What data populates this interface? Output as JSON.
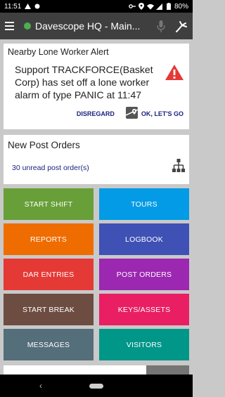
{
  "status_bar": {
    "time": "11:51",
    "battery": "80%",
    "icons": [
      "warning-icon",
      "circle-icon",
      "key-icon",
      "location-icon",
      "wifi-icon",
      "signal-icon",
      "battery-icon"
    ]
  },
  "app_bar": {
    "title": "Davescope HQ - Main...",
    "status_color": "#4caf50",
    "icons": [
      "menu-icon",
      "microphone-icon",
      "hand-icon"
    ]
  },
  "alert": {
    "title": "Nearby Lone Worker Alert",
    "message": "Support TRACKFORCE(Basket Corp) has set off a lone worker alarm of type PANIC at 11:47",
    "disregard_label": "DISREGARD",
    "confirm_label": "OK, LET'S GO",
    "warning_color": "#e53935"
  },
  "post_orders": {
    "title": "New Post Orders",
    "unread_text": "30 unread post order(s)"
  },
  "tiles": [
    {
      "label": "START SHIFT",
      "color": "#689f38"
    },
    {
      "label": "TOURS",
      "color": "#039be5"
    },
    {
      "label": "REPORTS",
      "color": "#ef6c00"
    },
    {
      "label": "LOGBOOK",
      "color": "#3f51b5"
    },
    {
      "label": "DAR ENTRIES",
      "color": "#e53935"
    },
    {
      "label": "POST ORDERS",
      "color": "#9c27b0"
    },
    {
      "label": "START BREAK",
      "color": "#6d4c41"
    },
    {
      "label": "KEYS/ASSETS",
      "color": "#e91e63"
    },
    {
      "label": "MESSAGES",
      "color": "#546e7a"
    },
    {
      "label": "VISITORS",
      "color": "#009688"
    }
  ]
}
